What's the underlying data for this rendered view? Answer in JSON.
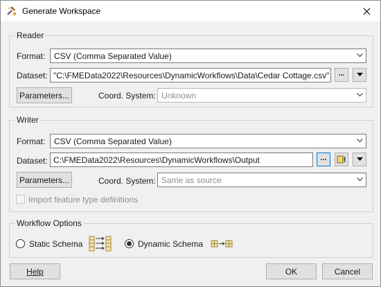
{
  "window": {
    "title": "Generate Workspace",
    "close_icon": "close-icon",
    "app_icon": "fme-workbench-icon"
  },
  "reader": {
    "group_title": "Reader",
    "format_label": "Format:",
    "format_value": "CSV (Comma Separated Value)",
    "dataset_label": "Dataset:",
    "dataset_value": "\"C:\\FMEData2022\\Resources\\DynamicWorkflows\\Data\\Cedar Cottage.csv\"",
    "browse_label": "...",
    "parameters_label": "Parameters...",
    "coord_label": "Coord. System:",
    "coord_value": "Unknown"
  },
  "writer": {
    "group_title": "Writer",
    "format_label": "Format:",
    "format_value": "CSV (Comma Separated Value)",
    "dataset_label": "Dataset:",
    "dataset_value": "C:\\FMEData2022\\Resources\\DynamicWorkflows\\Output",
    "browse_label": "...",
    "parameters_label": "Parameters...",
    "coord_label": "Coord. System:",
    "coord_value": "Same as source",
    "import_label": "Import feature type definitions",
    "import_checked": false
  },
  "workflow": {
    "group_title": "Workflow Options",
    "static_label": "Static Schema",
    "dynamic_label": "Dynamic Schema",
    "selected": "Dynamic Schema"
  },
  "footer": {
    "help_label": "Help",
    "ok_label": "OK",
    "cancel_label": "Cancel"
  }
}
